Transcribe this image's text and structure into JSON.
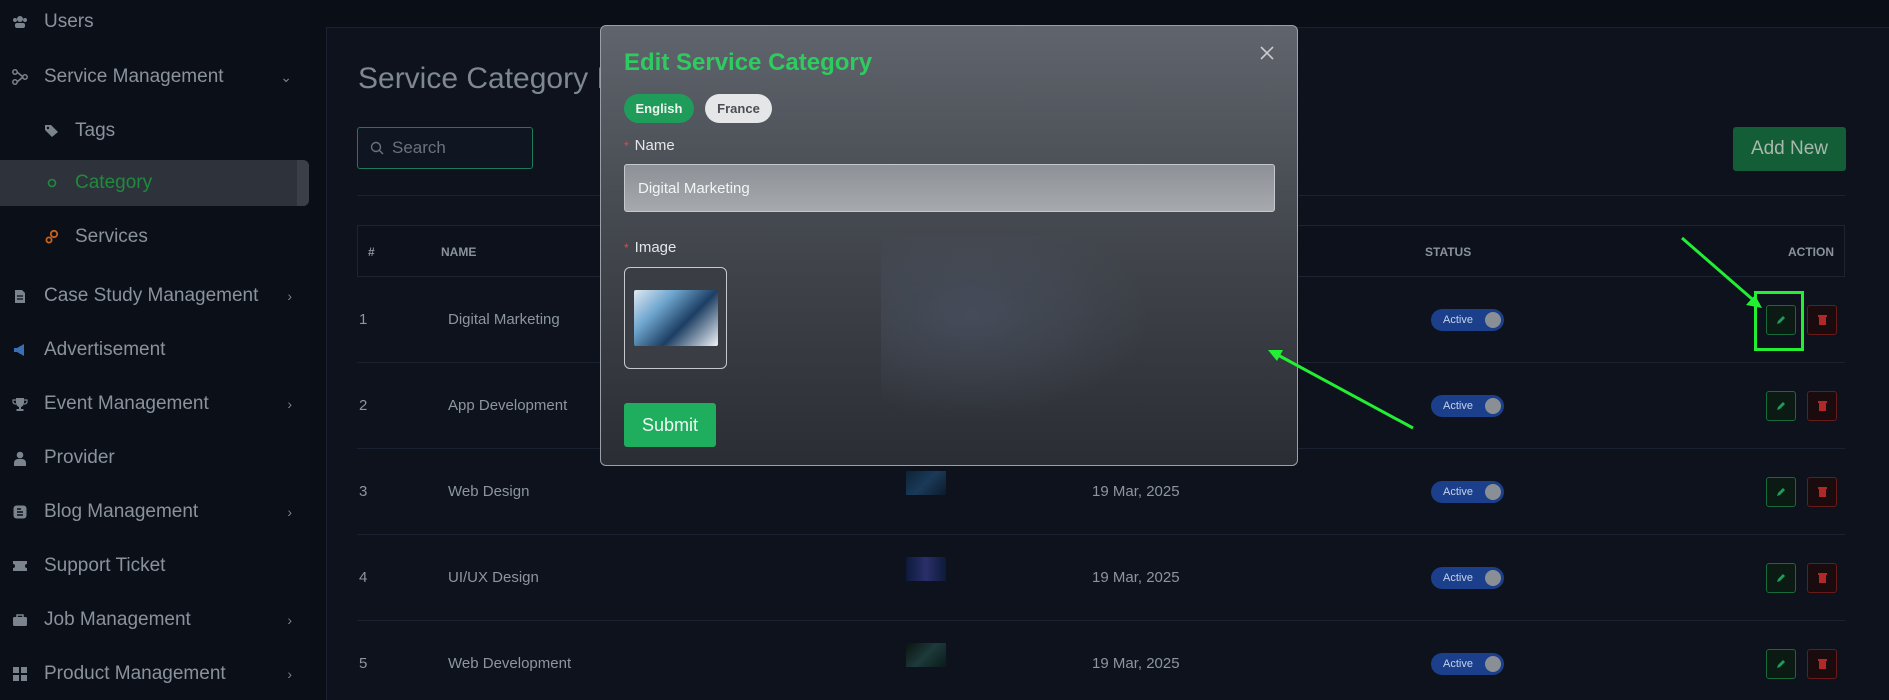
{
  "sidebar": {
    "items": [
      {
        "label": "Users",
        "icon": "users-icon"
      },
      {
        "label": "Service Management",
        "icon": "hierarchy-icon",
        "chevron": "⌄"
      },
      {
        "label": "Tags",
        "icon": "tags-icon"
      },
      {
        "label": "Category",
        "icon": "circle-icon"
      },
      {
        "label": "Services",
        "icon": "gears-icon"
      },
      {
        "label": "Case Study Management",
        "icon": "document-icon",
        "chevron": "›"
      },
      {
        "label": "Advertisement",
        "icon": "megaphone-icon"
      },
      {
        "label": "Event Management",
        "icon": "trophy-icon",
        "chevron": "›"
      },
      {
        "label": "Provider",
        "icon": "user-tie-icon"
      },
      {
        "label": "Blog Management",
        "icon": "blog-icon",
        "chevron": "›"
      },
      {
        "label": "Support Ticket",
        "icon": "ticket-icon"
      },
      {
        "label": "Job Management",
        "icon": "briefcase-icon",
        "chevron": "›"
      },
      {
        "label": "Product Management",
        "icon": "grid-icon",
        "chevron": "›"
      }
    ]
  },
  "page": {
    "title": "Service Category I",
    "search_placeholder": "Search",
    "add_label": "Add New"
  },
  "table": {
    "headers": {
      "num": "#",
      "name": "NAME",
      "status": "STATUS",
      "action": "ACTION"
    },
    "rows": [
      {
        "num": "1",
        "name": "Digital Marketing",
        "date": "",
        "status": "Active"
      },
      {
        "num": "2",
        "name": "App Development",
        "date": "",
        "status": "Active"
      },
      {
        "num": "3",
        "name": "Web Design",
        "date": "19 Mar, 2025",
        "status": "Active"
      },
      {
        "num": "4",
        "name": "UI/UX Design",
        "date": "19 Mar, 2025",
        "status": "Active"
      },
      {
        "num": "5",
        "name": "Web Development",
        "date": "19 Mar, 2025",
        "status": "Active"
      }
    ]
  },
  "modal": {
    "title": "Edit Service Category",
    "close": "×",
    "langs": {
      "en": "English",
      "fr": "France"
    },
    "name_label": "Name",
    "name_value": "Digital Marketing",
    "image_label": "Image",
    "required_mark": "*",
    "submit_label": "Submit"
  },
  "colors": {
    "accent_green": "#2ecc5f",
    "annotation": "#22ee33",
    "toggle_blue": "#1b3f8a",
    "delete_red": "#6b1a1a"
  }
}
